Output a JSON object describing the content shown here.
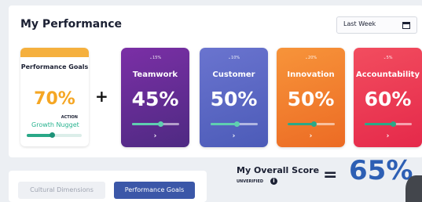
{
  "header": {
    "title": "My Performance",
    "date_range": "Last Week",
    "calendar_icon": "calendar-icon"
  },
  "goals_card": {
    "title": "Performance Goals",
    "percent": "70%",
    "action_label": "ACTION",
    "nugget_label": "Growth Nugget",
    "progress": 0.45,
    "colors": {
      "band": "#f5b03e",
      "percent": "#f5a623",
      "nugget": "#28b38f"
    }
  },
  "operator_plus": "+",
  "dimensions": [
    {
      "name": "Teamwork",
      "delta": "⌄15%",
      "percent": "45%",
      "progress": 0.6,
      "chevron": "›",
      "accent": "#5fcfb0"
    },
    {
      "name": "Customer",
      "delta": "⌄10%",
      "percent": "50%",
      "progress": 0.55,
      "chevron": "›",
      "accent": "#5fcfb0"
    },
    {
      "name": "Innovation",
      "delta": "⌄20%",
      "percent": "50%",
      "progress": 0.55,
      "chevron": "›",
      "accent": "#2aa887"
    },
    {
      "name": "Accountability",
      "delta": "⌄5%",
      "percent": "60%",
      "progress": 0.6,
      "chevron": "›",
      "accent": "#2aa887"
    }
  ],
  "tabs": [
    {
      "label": "Cultural Dimensions",
      "active": false
    },
    {
      "label": "Performance Goals",
      "active": true
    }
  ],
  "overall": {
    "title": "My Overall Score",
    "status": "UNVERIFIED",
    "info_icon": "i",
    "equals": "=",
    "score": "65%",
    "color": "#2d5fb4"
  }
}
